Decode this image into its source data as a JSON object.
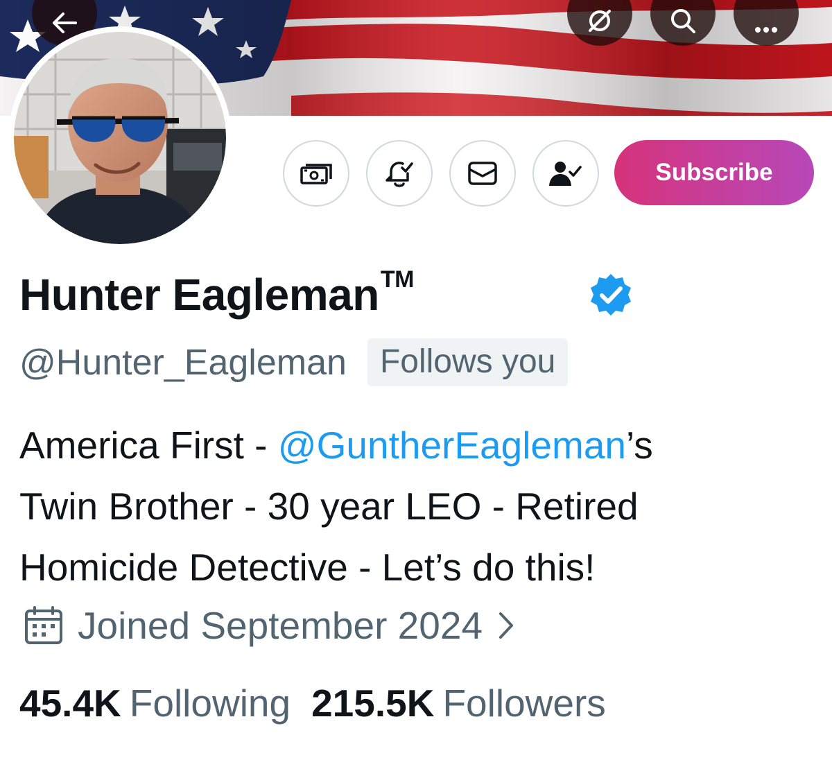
{
  "banner": {
    "image": "american-flag",
    "colors": {
      "red": "#c8161e",
      "white": "#f4f2f2",
      "blue": "#1c2b5c"
    }
  },
  "top_bar": {
    "back_icon": "arrow-left-icon",
    "grok_icon": "grok-icon",
    "search_icon": "search-icon",
    "more_icon": "more-dots-icon"
  },
  "profile": {
    "avatar": "profile-photo-man-sunglasses",
    "display_name": "Hunter Eagleman",
    "trademark": "TM",
    "verified": true,
    "handle": "@Hunter_Eagleman",
    "follows_you_label": "Follows you",
    "bio": {
      "line1_prefix": "America First - ",
      "line1_mention": "@GuntherEagleman",
      "line1_suffix": "’s",
      "line2": "Twin Brother - 30 year LEO - Retired",
      "line3": "Homicide Detective - Let’s do this!"
    },
    "joined": "Joined September 2024",
    "following_count": "45.4K",
    "following_label": "Following",
    "followers_count": "215.5K",
    "followers_label": "Followers"
  },
  "actions": {
    "tip_icon": "money-icon",
    "notify_icon": "bell-check-icon",
    "message_icon": "envelope-icon",
    "follow_icon": "person-check-icon",
    "subscribe_label": "Subscribe"
  },
  "colors": {
    "primary_text": "#0f1419",
    "secondary_text": "#536471",
    "link": "#1d9bf0",
    "verified": "#1d9bf0",
    "subscribe_gradient_start": "#d6337a",
    "subscribe_gradient_end": "#b748b8"
  }
}
